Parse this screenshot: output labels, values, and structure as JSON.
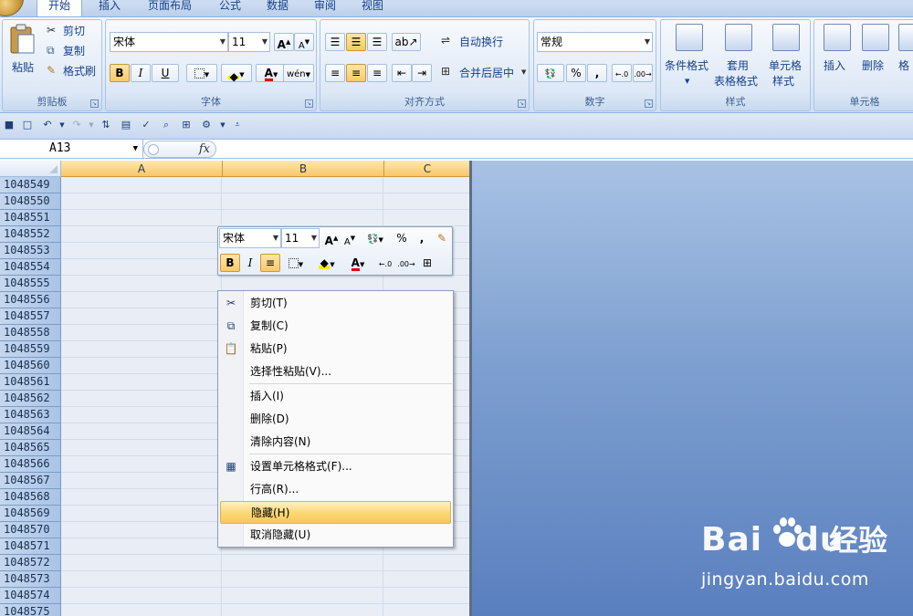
{
  "ribbon": {
    "tabs": [
      "开始",
      "插入",
      "页面布局",
      "公式",
      "数据",
      "审阅",
      "视图"
    ],
    "clipboard": {
      "paste": "粘贴",
      "cut": "剪切",
      "copy": "复制",
      "format_painter": "格式刷",
      "label": "剪贴板"
    },
    "font": {
      "name": "宋体",
      "size": "11",
      "bold": "B",
      "italic": "I",
      "underline": "U",
      "label": "字体"
    },
    "alignment": {
      "wrap": "自动换行",
      "merge": "合并后居中",
      "label": "对齐方式"
    },
    "number": {
      "format": "常规",
      "percent": "%",
      "comma": ",",
      "label": "数字"
    },
    "styles": {
      "conditional": "条件格式",
      "table_1": "套用",
      "table_2": "表格格式",
      "cell_1": "单元格",
      "cell_2": "样式",
      "label": "样式"
    },
    "cells": {
      "insert": "插入",
      "delete": "删除",
      "format": "格",
      "label": "单元格"
    }
  },
  "formula_bar": {
    "name_box": "A13",
    "fx": "fx"
  },
  "sheet": {
    "columns": [
      "A",
      "B",
      "C"
    ],
    "rows": [
      "1048549",
      "1048550",
      "1048551",
      "1048552",
      "1048553",
      "1048554",
      "1048555",
      "1048556",
      "1048557",
      "1048558",
      "1048559",
      "1048560",
      "1048561",
      "1048562",
      "1048563",
      "1048564",
      "1048565",
      "1048566",
      "1048567",
      "1048568",
      "1048569",
      "1048570",
      "1048571",
      "1048572",
      "1048573",
      "1048574",
      "1048575"
    ]
  },
  "mini_toolbar": {
    "font": "宋体",
    "size": "11",
    "percent": "%",
    "comma": ",",
    "bold": "B",
    "italic": "I"
  },
  "context_menu": {
    "items": [
      {
        "label": "剪切(T)"
      },
      {
        "label": "复制(C)"
      },
      {
        "label": "粘贴(P)"
      },
      {
        "label": "选择性粘贴(V)..."
      },
      {
        "label": "插入(I)"
      },
      {
        "label": "删除(D)"
      },
      {
        "label": "清除内容(N)"
      },
      {
        "label": "设置单元格格式(F)..."
      },
      {
        "label": "行高(R)..."
      },
      {
        "label": "隐藏(H)"
      },
      {
        "label": "取消隐藏(U)"
      }
    ],
    "highlighted": "隐藏(H)"
  },
  "watermark": {
    "logo": "Bai",
    "logo2": "du",
    "cn": "经验",
    "url": "jingyan.baidu.com"
  },
  "colors": {
    "accent": "#15428b",
    "highlight": "#fbd773",
    "desktop": "#7d9fd0"
  }
}
